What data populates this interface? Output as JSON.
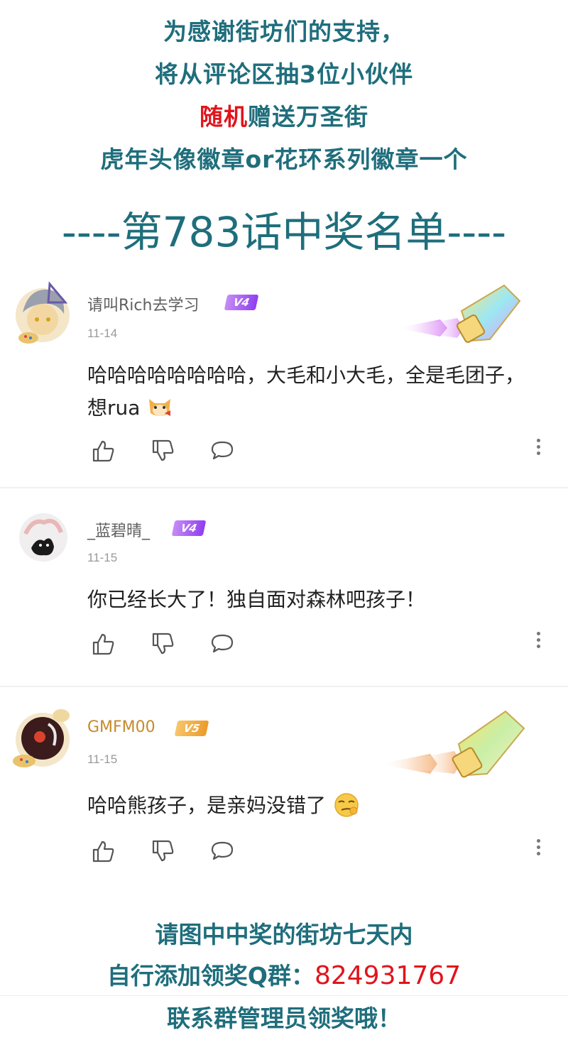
{
  "header": {
    "line1": "为感谢街坊们的支持，",
    "line2": "将从评论区抽3位小伙伴",
    "line3_red": "随机",
    "line3_rest": "赠送万圣街",
    "line4": "虎年头像徽章or花环系列徽章一个",
    "winners_title": "----第783话中奖名单----"
  },
  "comments": [
    {
      "username": "请叫Rich去学习",
      "badge": "V4",
      "date": "11-14",
      "text": "哈哈哈哈哈哈哈哈，大毛和小大毛，全是毛团子，想rua"
    },
    {
      "username": "_蓝碧晴_",
      "badge": "V4",
      "date": "11-15",
      "text": "你已经长大了！独自面对森林吧孩子！"
    },
    {
      "username": "GMFM00",
      "badge": "V5",
      "date": "11-15",
      "text": "哈哈熊孩子，是亲妈没错了"
    }
  ],
  "footer": {
    "line1": "请图中中奖的街坊七天内",
    "line2_prefix": "自行添加领奖Q群：",
    "line2_number": "824931767",
    "line3": "联系群管理员领奖哦！"
  },
  "icons": {
    "like": "thumbs-up-icon",
    "dislike": "thumbs-down-icon",
    "reply": "comment-icon",
    "more": "more-vertical-icon"
  },
  "colors": {
    "teal": "#1f6e7c",
    "red": "#e0141c",
    "v4": "#a85ef2",
    "v5": "#ec9a2a"
  }
}
